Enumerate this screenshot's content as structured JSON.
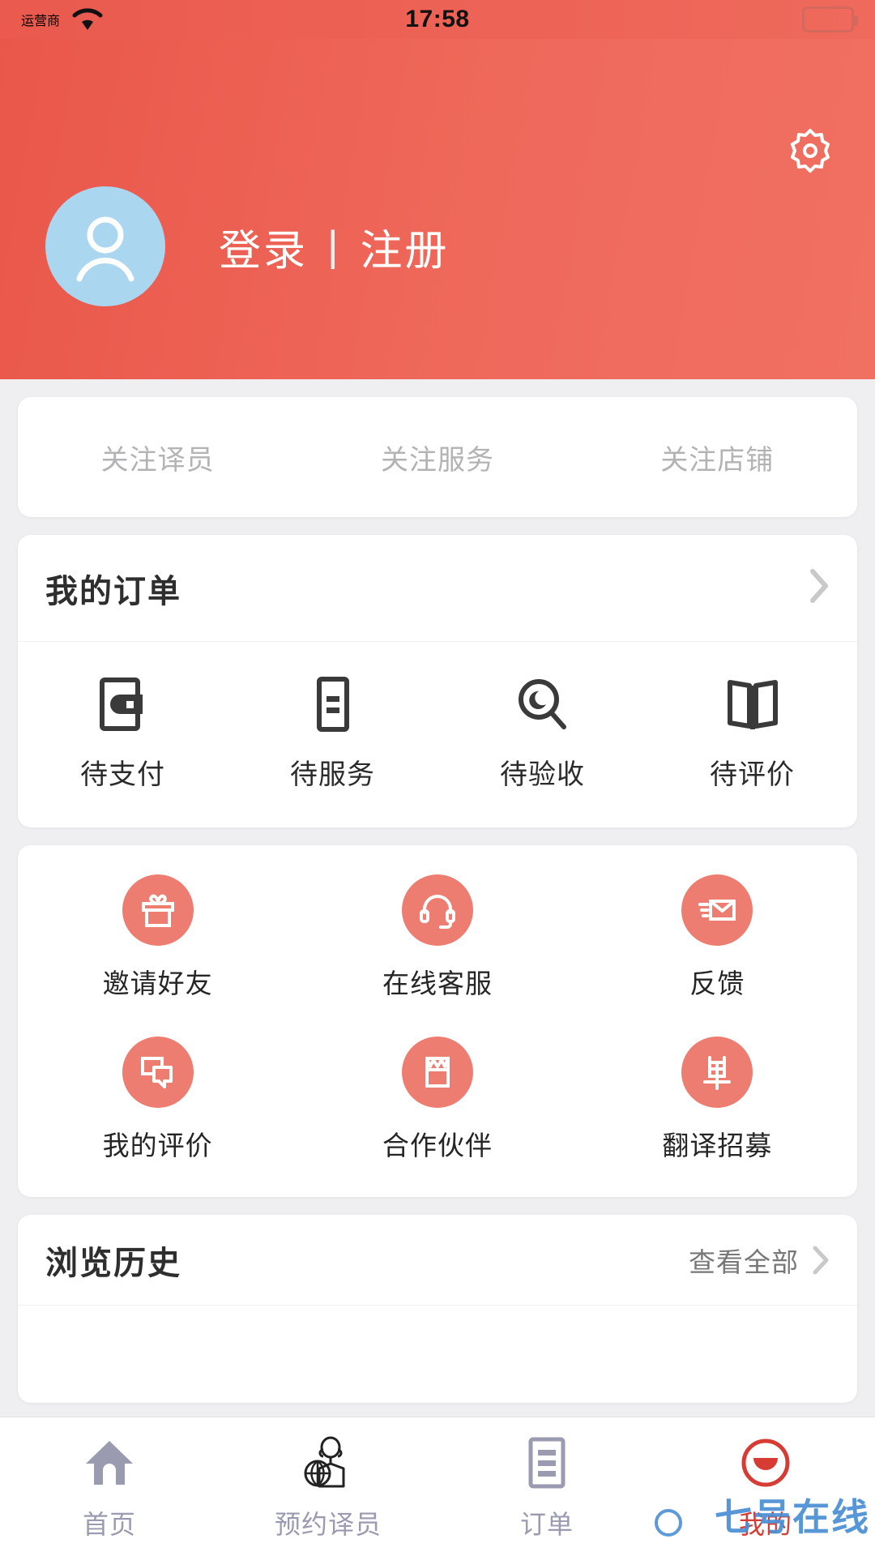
{
  "status_bar": {
    "carrier": "运营商",
    "time": "17:58",
    "wifi_icon": "wifi-icon",
    "battery_icon": "battery-icon"
  },
  "header": {
    "background_color": "#ee6155",
    "settings_icon": "gear-icon",
    "avatar_icon": "user-avatar-icon",
    "avatar_background": "#aad6f0",
    "login_label": "登录",
    "separator": "|",
    "register_label": "注册"
  },
  "follow": {
    "items": [
      {
        "label": "关注译员",
        "icon": "follow-interpreter"
      },
      {
        "label": "关注服务",
        "icon": "follow-service"
      },
      {
        "label": "关注店铺",
        "icon": "follow-shop"
      }
    ]
  },
  "orders": {
    "title": "我的订单",
    "chevron_icon": "chevron-right-icon",
    "items": [
      {
        "label": "待支付",
        "icon": "wallet-icon"
      },
      {
        "label": "待服务",
        "icon": "document-icon"
      },
      {
        "label": "待验收",
        "icon": "search-eye-icon"
      },
      {
        "label": "待评价",
        "icon": "open-book-icon"
      }
    ]
  },
  "services": {
    "accent_color": "#ed7d70",
    "rows": [
      [
        {
          "label": "邀请好友",
          "icon": "gift-icon"
        },
        {
          "label": "在线客服",
          "icon": "headset-icon"
        },
        {
          "label": "反馈",
          "icon": "mail-icon"
        }
      ],
      [
        {
          "label": "我的评价",
          "icon": "chat-bubble-icon"
        },
        {
          "label": "合作伙伴",
          "icon": "shop-icon"
        },
        {
          "label": "翻译招募",
          "icon": "dan-character-icon"
        }
      ]
    ]
  },
  "history": {
    "title": "浏览历史",
    "view_all_label": "查看全部",
    "chevron_icon": "chevron-right-icon"
  },
  "bottom_nav": {
    "active_color": "#d63b34",
    "inactive_color": "#9a9ab0",
    "items": [
      {
        "label": "首页",
        "icon": "home-icon",
        "active": false
      },
      {
        "label": "预约译员",
        "icon": "interpreter-person-icon",
        "active": false
      },
      {
        "label": "订单",
        "icon": "list-icon",
        "active": false
      },
      {
        "label": "我的",
        "icon": "profile-circle-icon",
        "active": true
      }
    ]
  },
  "watermark": {
    "text": "七号在线"
  }
}
